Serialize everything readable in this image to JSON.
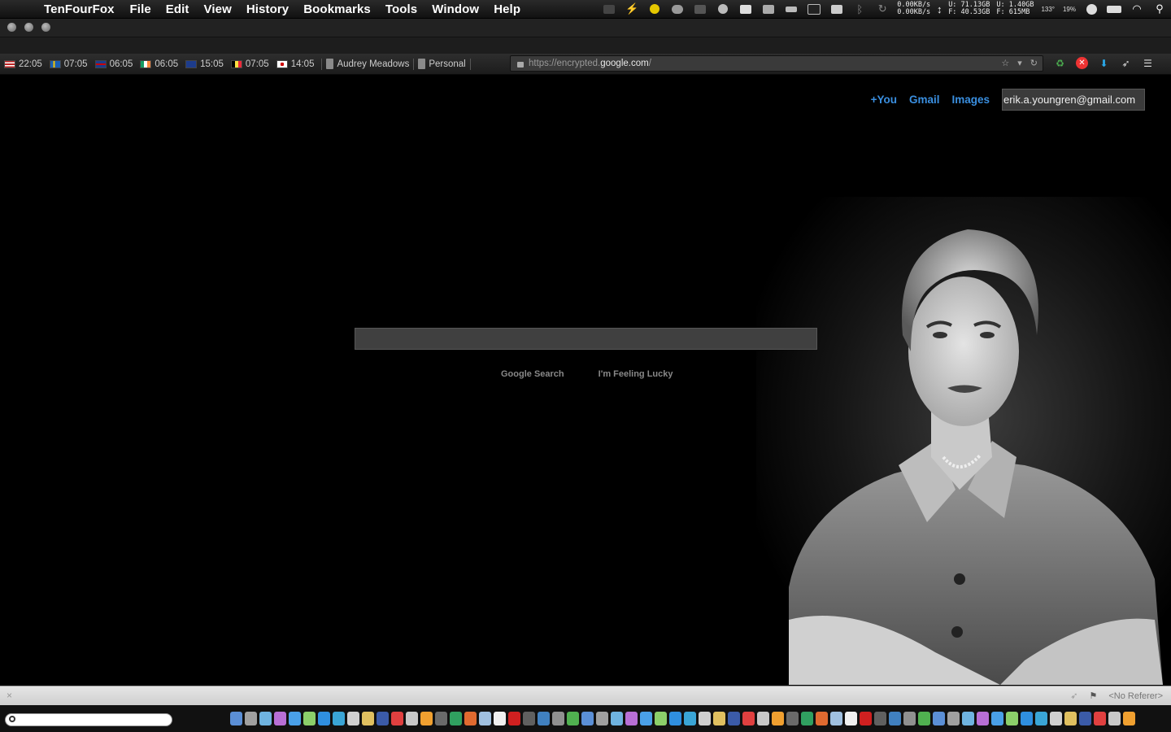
{
  "menubar": {
    "apple_glyph": "",
    "app_name": "TenFourFox",
    "menus": [
      "File",
      "Edit",
      "View",
      "History",
      "Bookmarks",
      "Tools",
      "Window",
      "Help"
    ],
    "net_stats": {
      "up": "0.00KB/s",
      "down": "0.00KB/s"
    },
    "disk": {
      "used": "U: 71.13GB",
      "free": "F: 40.53GB"
    },
    "memory": {
      "used": "U:   1.40GB",
      "free": "F:   615MB"
    },
    "temperature": "133°",
    "cpu": "19%"
  },
  "bookmarks_bar": {
    "clocks": [
      {
        "flag": "us",
        "time": "22:05"
      },
      {
        "flag": "se",
        "time": "07:05"
      },
      {
        "flag": "gb",
        "time": "06:05"
      },
      {
        "flag": "ie",
        "time": "06:05"
      },
      {
        "flag": "au",
        "time": "15:05"
      },
      {
        "flag": "be",
        "time": "07:05"
      },
      {
        "flag": "jp",
        "time": "14:05"
      }
    ],
    "folders": [
      "Audrey Meadows",
      "Personal"
    ]
  },
  "urlbar": {
    "scheme": "https://",
    "subdomain": "encrypted.",
    "host": "google.com",
    "path": "/"
  },
  "page": {
    "top_links": [
      "+You",
      "Gmail",
      "Images"
    ],
    "account_email": "erik.a.youngren@gmail.com",
    "search_button": "Google Search",
    "lucky_button": "I'm Feeling Lucky"
  },
  "statusbar": {
    "close_glyph": "×",
    "referer": "<No Referer>"
  },
  "colors": {
    "link": "#3a8fe0",
    "background": "#000000"
  }
}
